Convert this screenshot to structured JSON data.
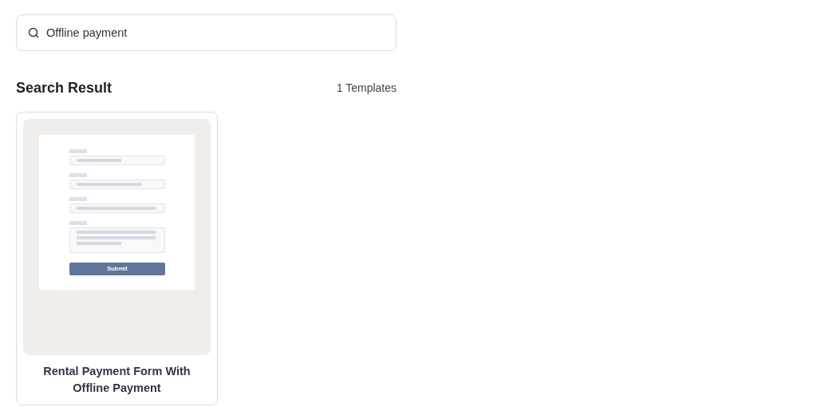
{
  "search": {
    "value": "Offline payment"
  },
  "results": {
    "title": "Search Result",
    "count": "1 Templates"
  },
  "templates": [
    {
      "title": "Rental Payment Form With Offline Payment",
      "preview": {
        "button_label": "Submit"
      }
    }
  ]
}
